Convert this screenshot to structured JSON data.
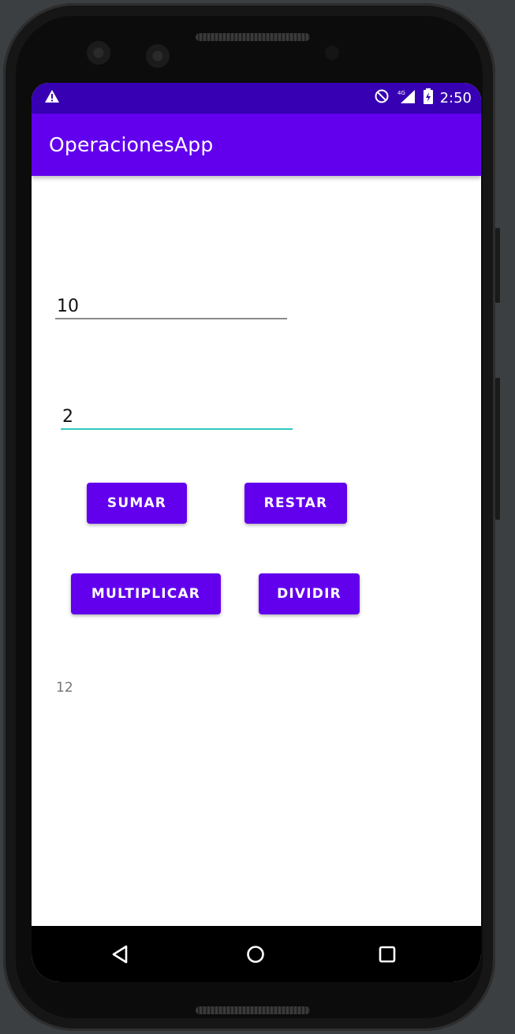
{
  "status_bar": {
    "time": "2:50",
    "icons": [
      "warning-icon",
      "do-not-disturb-icon",
      "signal-4g-icon",
      "battery-charging-icon"
    ]
  },
  "app_bar": {
    "title": "OperacionesApp"
  },
  "inputs": {
    "first_number": {
      "value": "10"
    },
    "second_number": {
      "value": "2"
    }
  },
  "buttons": {
    "sumar": "SUMAR",
    "restar": "RESTAR",
    "multiplicar": "MULTIPLICAR",
    "dividir": "DIVIDIR"
  },
  "result": {
    "value": "12"
  },
  "nav_bar": {
    "icons": [
      "back-icon",
      "home-icon",
      "recents-icon"
    ]
  },
  "colors": {
    "primary": "#6200ee",
    "primary_dark": "#3700b3",
    "accent_underline": "#2ec8bf",
    "result_text": "#757575"
  }
}
